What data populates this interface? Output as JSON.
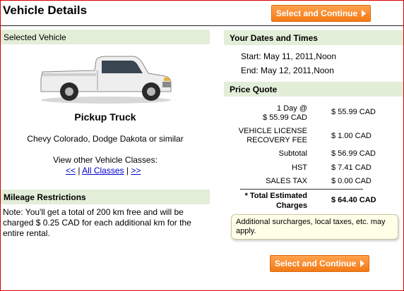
{
  "header": {
    "title": "Vehicle Details",
    "continue_label": "Select and Continue"
  },
  "selected_vehicle": {
    "section_label": "Selected Vehicle",
    "vehicle_name": "Pickup Truck",
    "vehicle_models": "Chevy Colorado, Dodge Dakota or similar",
    "other_classes_label": "View other Vehicle Classes:",
    "prev_link": "<<",
    "sep1": "|",
    "all_classes_link": "All Classes",
    "sep2": "|",
    "next_link": ">>"
  },
  "mileage": {
    "section_label": "Mileage Restrictions",
    "note": "Note: You'll get a total of 200 km free and will be charged $ 0.25 CAD for each additional km for the entire rental."
  },
  "dates": {
    "section_label": "Your Dates and Times",
    "start_label": "Start:",
    "start_value": "May 11, 2011,Noon",
    "end_label": "End:",
    "end_value": "May 12, 2011,Noon"
  },
  "price_quote": {
    "section_label": "Price Quote",
    "rows": [
      {
        "label": "1 Day  @\n$ 55.99 CAD",
        "value": "$ 55.99 CAD"
      },
      {
        "label": "VEHICLE LICENSE\nRECOVERY FEE",
        "value": "$ 1.00 CAD"
      },
      {
        "label": "Subtotal",
        "value": "$ 56.99 CAD"
      },
      {
        "label": "HST",
        "value": "$ 7.41 CAD"
      },
      {
        "label": "SALES TAX",
        "value": "$ 0.00 CAD"
      }
    ],
    "total_label": "* Total Estimated\nCharges",
    "total_value": "$ 64.40 CAD",
    "surcharge_note": "Additional surcharges, local taxes, etc. may apply."
  },
  "colors": {
    "accent": "#f47a16",
    "section_bg": "#e3eed9",
    "link": "#0000cc",
    "frame": "#d40000"
  }
}
